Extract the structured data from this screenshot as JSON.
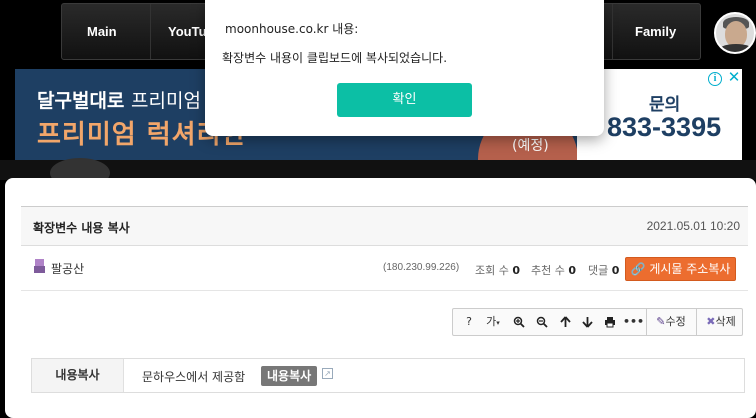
{
  "nav": {
    "items": [
      "Main",
      "YouTu",
      "Family"
    ]
  },
  "ad": {
    "line1_bold": "달구벌대로",
    "line1_light": "프리미엄 리",
    "line2": "프리미엄 럭셔리한",
    "badge": "(예정)",
    "phone_label": "문의",
    "phone": "833-3395",
    "info_icon": "i",
    "close_icon": "✕"
  },
  "post": {
    "title": "확장변수 내용 복사",
    "date": "2021.05.01 10:20",
    "author": "팔공산",
    "ip": "(180.230.99.226)",
    "views_label": "조회 수",
    "views": "0",
    "recommends_label": "추천 수",
    "recommends": "0",
    "comments_label": "댓글",
    "comments": "0",
    "copy_url_label": "게시물 주소복사"
  },
  "toolbar": {
    "help": "?",
    "font": "가",
    "edit": "수정",
    "delete": "삭제"
  },
  "content": {
    "label": "내용복사",
    "text": "문하우스에서 제공함",
    "copy_tag": "내용복사"
  },
  "dialog": {
    "title": "moonhouse.co.kr 내용:",
    "message": "확장변수 내용이 클립보드에 복사되었습니다.",
    "ok": "확인"
  },
  "colors": {
    "ok_button": "#0cbfa5",
    "copy_url_button": "#ec6d2f",
    "ad_background": "#1e3f63"
  }
}
